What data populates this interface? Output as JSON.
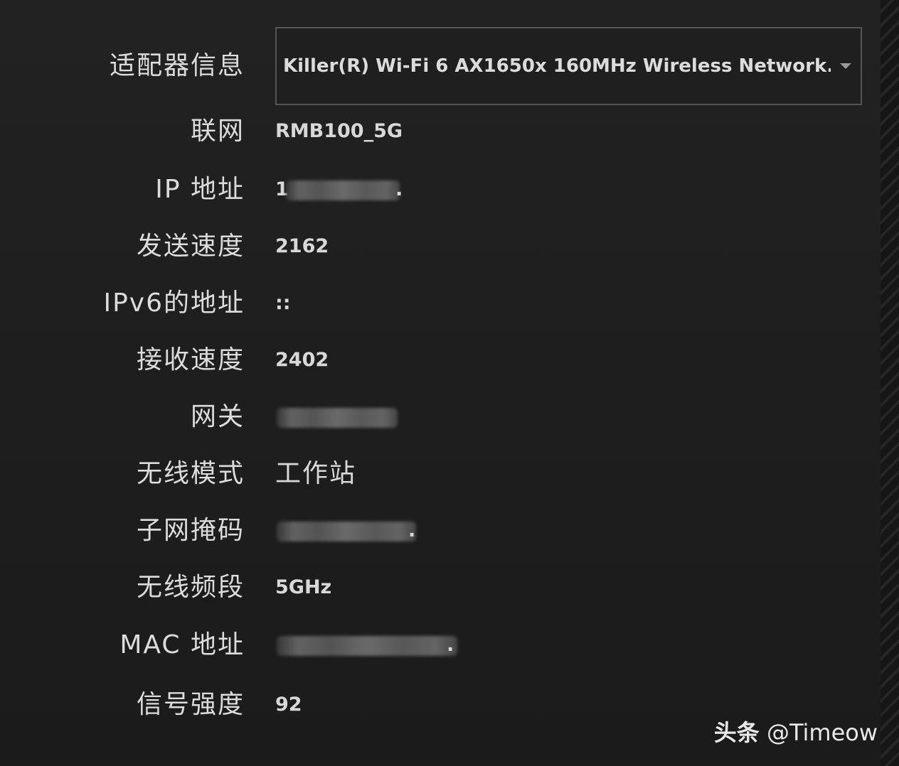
{
  "adapter": {
    "label": "适配器信息",
    "selected": "Killer(R) Wi-Fi 6 AX1650x 160MHz Wireless Network..."
  },
  "rows": [
    {
      "key": "network",
      "label": "联网",
      "value": "RMB100_5G"
    },
    {
      "key": "ip",
      "label": "IP 地址",
      "value": "1",
      "value_tail": "."
    },
    {
      "key": "send_speed",
      "label": "发送速度",
      "value": "2162"
    },
    {
      "key": "ipv6",
      "label": "IPv6的地址",
      "value": "::"
    },
    {
      "key": "recv_speed",
      "label": "接收速度",
      "value": "2402"
    },
    {
      "key": "gateway",
      "label": "网关",
      "value": ""
    },
    {
      "key": "wireless_mode",
      "label": "无线模式",
      "value": "工作站"
    },
    {
      "key": "subnet",
      "label": "子网掩码",
      "value": "",
      "value_tail": "."
    },
    {
      "key": "band",
      "label": "无线频段",
      "value": "5GHz"
    },
    {
      "key": "mac",
      "label": "MAC 地址",
      "value": "",
      "value_tail": "."
    },
    {
      "key": "signal",
      "label": "信号强度",
      "value": "92"
    }
  ],
  "watermark": {
    "brand": "头条",
    "handle": "@Timeow"
  },
  "colors": {
    "background": "#1e1e1e",
    "text": "#d9d9d9",
    "select_border": "#555555"
  },
  "icons": {
    "dropdown": "caret-down-icon"
  }
}
